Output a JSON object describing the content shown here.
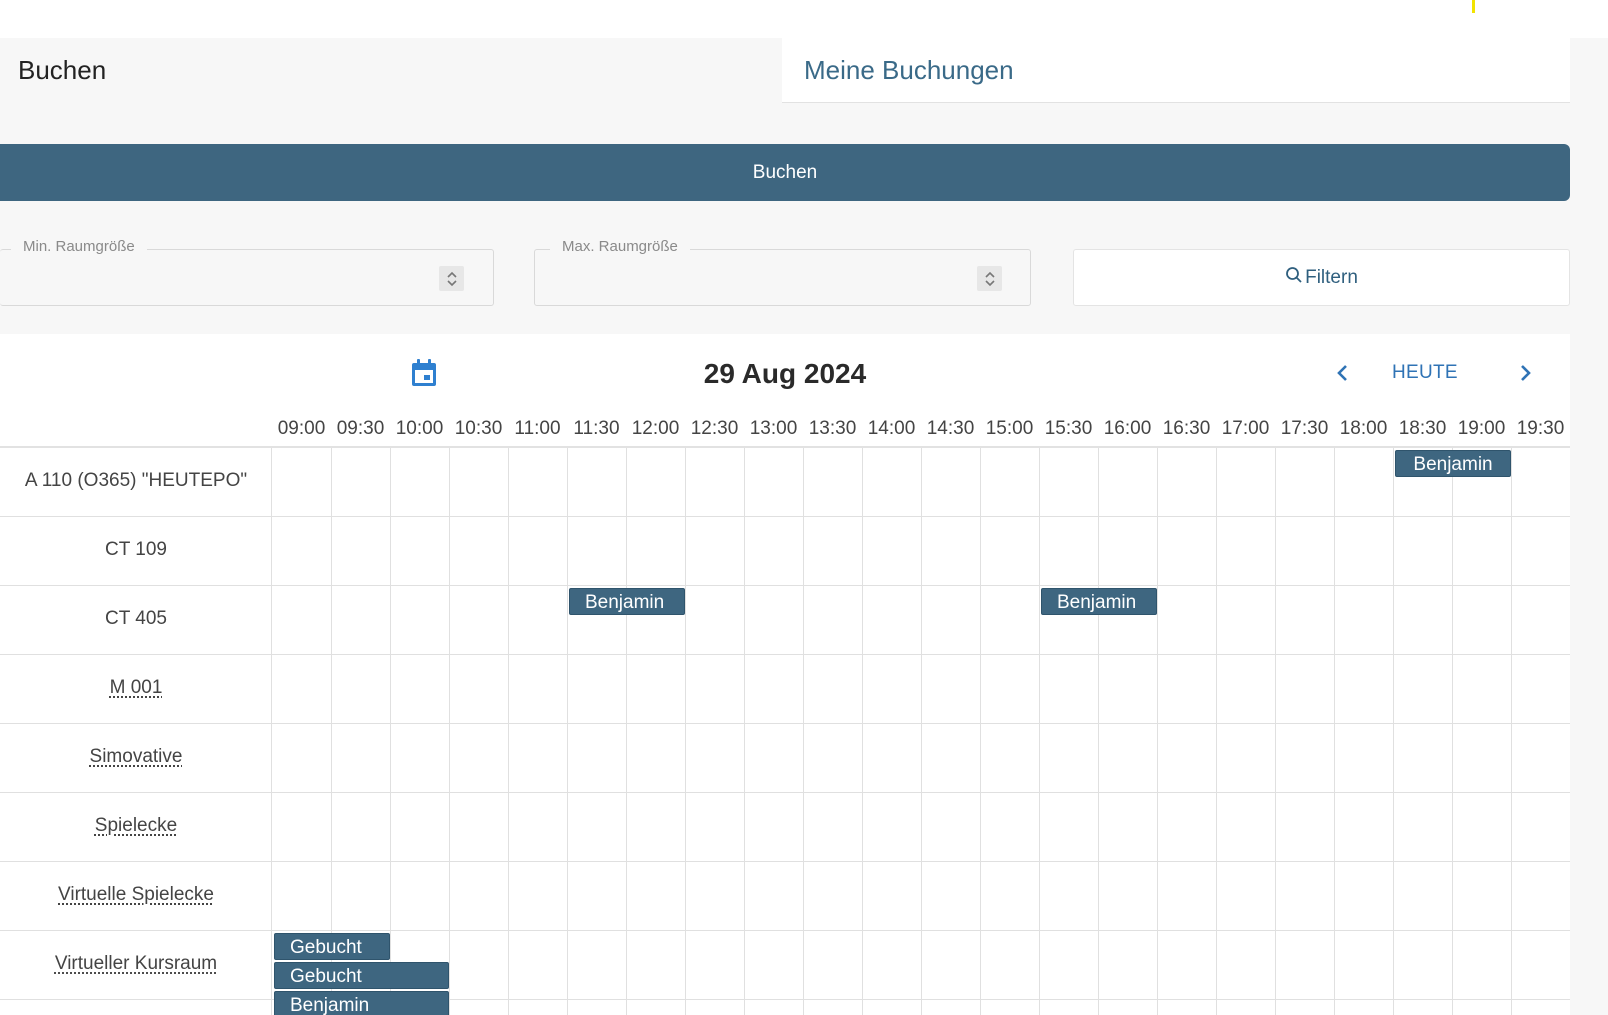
{
  "tabs": {
    "buchen": "Buchen",
    "meine_buchungen": "Meine Buchungen"
  },
  "book_button": "Buchen",
  "filters": {
    "min_label": "Min. Raumgröße",
    "max_label": "Max. Raumgröße",
    "min_value": "",
    "max_value": "",
    "filter_button": "Filtern"
  },
  "calendar": {
    "date": "29 Aug 2024",
    "today_label": "HEUTE",
    "times": [
      "09:00",
      "09:30",
      "10:00",
      "10:30",
      "11:00",
      "11:30",
      "12:00",
      "12:30",
      "13:00",
      "13:30",
      "14:00",
      "14:30",
      "15:00",
      "15:30",
      "16:00",
      "16:30",
      "17:00",
      "17:30",
      "18:00",
      "18:30",
      "19:00",
      "19:30"
    ],
    "rooms": [
      {
        "name": "A 110 (O365) \"HEUTEPO\"",
        "linked": false
      },
      {
        "name": "CT 109",
        "linked": false
      },
      {
        "name": "CT 405",
        "linked": false
      },
      {
        "name": "M 001",
        "linked": true
      },
      {
        "name": "Simovative",
        "linked": true
      },
      {
        "name": "Spielecke",
        "linked": true
      },
      {
        "name": "Virtuelle Spielecke",
        "linked": true
      },
      {
        "name": "Virtueller Kursraum",
        "linked": true
      }
    ],
    "events": [
      {
        "room": 0,
        "start": "18:30",
        "end": "19:30",
        "label": "Benjamin",
        "lane": 0
      },
      {
        "room": 2,
        "start": "11:30",
        "end": "12:30",
        "label": "Benjamin",
        "lane": 0
      },
      {
        "room": 2,
        "start": "15:30",
        "end": "16:30",
        "label": "Benjamin",
        "lane": 0
      },
      {
        "room": 7,
        "start": "09:00",
        "end": "10:00",
        "label": "Gebucht",
        "lane": 0
      },
      {
        "room": 7,
        "start": "09:00",
        "end": "10:30",
        "label": "Gebucht",
        "lane": 1
      },
      {
        "room": 7,
        "start": "09:00",
        "end": "10:30",
        "label": "Benjamin",
        "lane": 2
      }
    ]
  },
  "colors": {
    "primary": "#3e6680",
    "link_blue": "#2f73b5",
    "tab_active_text": "#3a6a88"
  },
  "icons": {
    "calendar": "calendar-icon",
    "prev": "chevron-left-icon",
    "next": "chevron-right-icon",
    "search": "search-icon",
    "spinner": "spinner-arrows-icon"
  }
}
